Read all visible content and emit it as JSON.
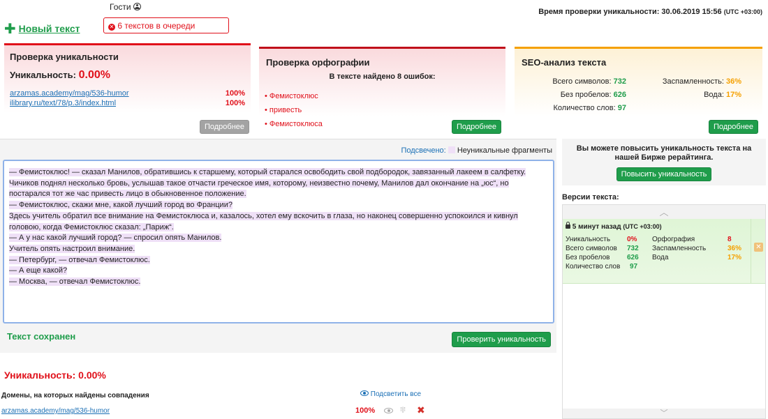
{
  "header": {
    "guest_label": "Гости",
    "new_text": "Новый текст",
    "queue": "6 текстов в очереди",
    "check_time_label": "Время проверки уникальности: 30.06.2019 15:56",
    "check_time_tz": "(UTC +03:00)"
  },
  "uniq_card": {
    "title": "Проверка уникальности",
    "uniq_label": "Уникальность:",
    "uniq_value": "0.00%",
    "links": [
      {
        "url": "arzamas.academy/mag/536-humor",
        "pct": "100%"
      },
      {
        "url": "ilibrary.ru/text/78/p.3/index.html",
        "pct": "100%"
      }
    ],
    "more": "Подробнее"
  },
  "spell_card": {
    "title": "Проверка орфографии",
    "found": "В тексте найдено 8 ошибок:",
    "errors": [
      "Фемистоклюс",
      "привесть",
      "Фемистоклюса"
    ],
    "more": "Подробнее"
  },
  "seo_card": {
    "title": "SEO-анализ текста",
    "chars_label": "Всего символов:",
    "chars": "732",
    "nospace_label": "Без пробелов:",
    "nospace": "626",
    "words_label": "Количество слов:",
    "words": "97",
    "spam_label": "Заспамленность:",
    "spam": "36%",
    "water_label": "Вода:",
    "water": "17%",
    "more": "Подробнее"
  },
  "editor": {
    "legend_label": "Подсвечено:",
    "legend_value": "Неуникальные фрагменты",
    "lines": [
      "— Фемистоклюс! — сказал Манилов, обратившись к старшему, который старался освободить свой подбородок, завязанный лакеем в салфетку.",
      "Чичиков поднял несколько бровь, услышав такое отчасти греческое имя, которому, неизвестно почему, Манилов дал окончание на „юс“, но",
      "постарался тот же час привесть лицо в обыкновенное положение.",
      "— Фемистоклюс, скажи мне, какой лучший город во Франции?",
      "Здесь учитель обратил все внимание на Фемистоклюса и, казалось, хотел ему вскочить в глаза, но наконец совершенно успокоился и кивнул",
      "головою, когда Фемистоклюс сказал: „Париж“.",
      "— А у нас какой лучший город? — спросил опять Манилов.",
      "Учитель опять настроил внимание.",
      "— Петербург, — отвечал Фемистоклюс.",
      "— А еще какой?",
      "— Москва, — отвечал Фемистоклюс."
    ],
    "saved": "Текст сохранен",
    "check_button": "Проверить уникальность"
  },
  "bottom": {
    "uniq": "Уникальность: 0.00%",
    "domains_label": "Домены, на которых найдены совпадения",
    "highlight_all": "Подсветить все",
    "row_url": "arzamas.academy/mag/536-humor",
    "row_pct": "100%"
  },
  "sidebar": {
    "promo": "Вы можете повысить уникальность текста на нашей Бирже рерайтинга.",
    "promo_button": "Повысить уникальность",
    "versions_title": "Версии текста:",
    "version": {
      "time": "5 минут назад",
      "tz": "(UTC +03:00)",
      "uniq_label": "Уникальность",
      "uniq": "0%",
      "spell_label": "Орфография",
      "spell": "8",
      "chars_label": "Всего символов",
      "chars": "732",
      "spam_label": "Заспамленность",
      "spam": "36%",
      "nospace_label": "Без пробелов",
      "nospace": "626",
      "water_label": "Вода",
      "water": "17%",
      "words_label": "Количество слов",
      "words": "97"
    }
  },
  "colors": {
    "red": "#e0101a",
    "green": "#1f9d4b",
    "orange": "#f5a000",
    "link": "#1a6fb5"
  }
}
